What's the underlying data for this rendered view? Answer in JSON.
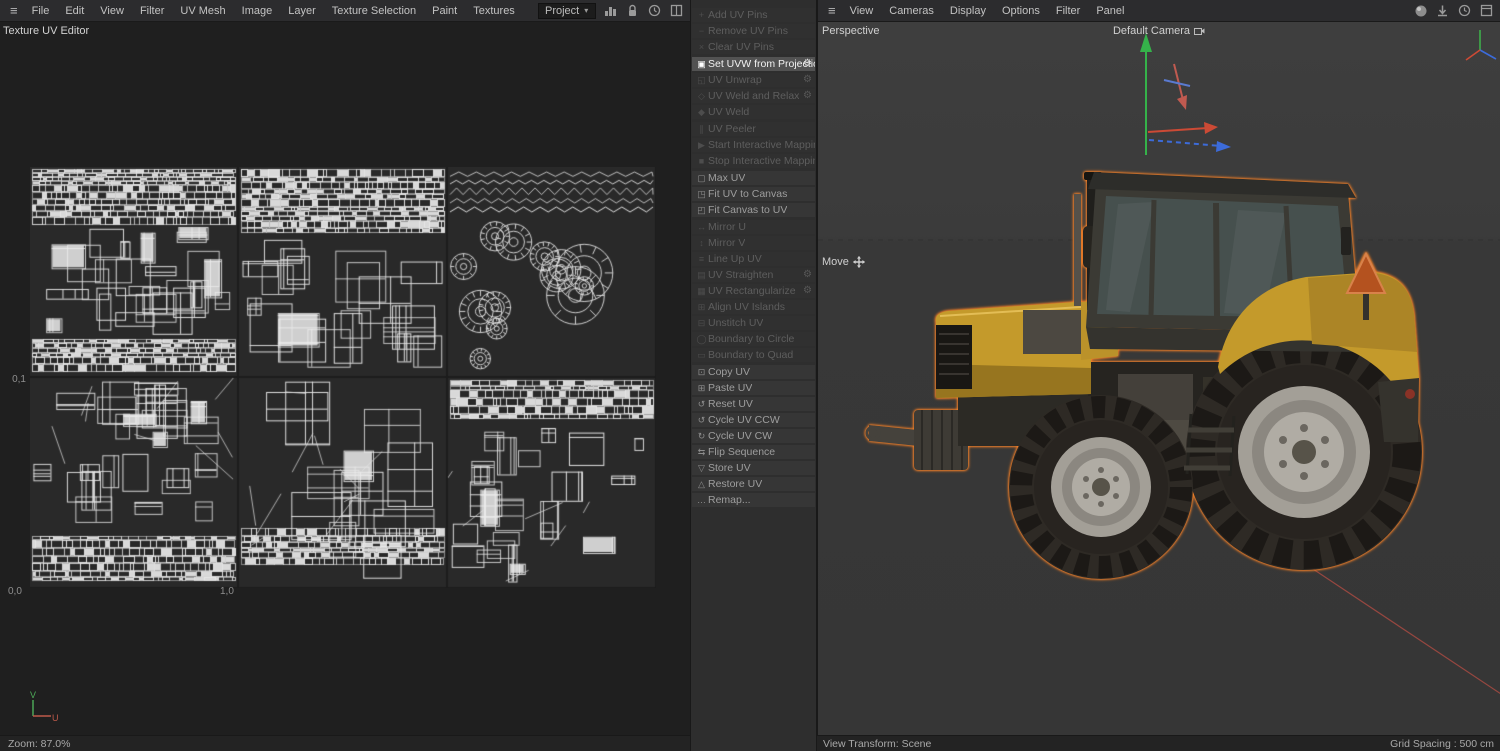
{
  "colors": {
    "accent_yellow": "#c49a2b",
    "selection_outline": "#ff8426",
    "axis_x": "#cc4a35",
    "axis_y": "#35b24a",
    "axis_z": "#3c6bd9"
  },
  "left_menubar": {
    "items": [
      "File",
      "Edit",
      "View",
      "Filter",
      "UV Mesh",
      "Image",
      "Layer",
      "Texture Selection",
      "Paint",
      "Textures"
    ]
  },
  "project_bar": {
    "selector_label": "Project"
  },
  "uv_editor": {
    "title": "Texture UV Editor",
    "coord_labels": {
      "v1": "0,1",
      "origin": "0,0",
      "u1": "1,0"
    },
    "axis": {
      "v": "V",
      "u": "U"
    },
    "status_zoom": "Zoom: 87.0%"
  },
  "command_panel": {
    "groups": [
      {
        "items": [
          {
            "label": "Add UV Pins",
            "icon": "add-pin",
            "glyph": "+",
            "state": "disabled",
            "gear": false
          },
          {
            "label": "Remove UV Pins",
            "icon": "remove-pin",
            "glyph": "−",
            "state": "disabled",
            "gear": false
          },
          {
            "label": "Clear UV Pins",
            "icon": "clear-pins",
            "glyph": "×",
            "state": "disabled",
            "gear": false
          }
        ]
      },
      {
        "items": [
          {
            "label": "Set UVW from Projection",
            "icon": "checkbox-checked",
            "glyph": "▣",
            "state": "active",
            "gear": true
          },
          {
            "label": "UV Unwrap",
            "icon": "uv-unwrap",
            "glyph": "◱",
            "state": "disabled",
            "gear": true
          },
          {
            "label": "UV Weld and Relax",
            "icon": "uv-weld-relax",
            "glyph": "◇",
            "state": "disabled",
            "gear": true
          },
          {
            "label": "UV Weld",
            "icon": "uv-weld",
            "glyph": "◆",
            "state": "disabled",
            "gear": false
          }
        ]
      },
      {
        "items": [
          {
            "label": "UV Peeler",
            "icon": "uv-peeler",
            "glyph": "∥",
            "state": "disabled",
            "gear": false
          },
          {
            "label": "Start Interactive Mapping",
            "icon": "start-interactive-mapping",
            "glyph": "▶",
            "state": "disabled",
            "gear": false
          },
          {
            "label": "Stop Interactive Mapping",
            "icon": "stop-interactive-mapping",
            "glyph": "■",
            "state": "disabled",
            "gear": false
          }
        ]
      },
      {
        "items": [
          {
            "label": "Max UV",
            "icon": "max-uv",
            "glyph": "▢",
            "state": "normal",
            "gear": false
          },
          {
            "label": "Fit UV to Canvas",
            "icon": "fit-uv-to-canvas",
            "glyph": "◳",
            "state": "normal",
            "gear": false
          },
          {
            "label": "Fit Canvas to UV",
            "icon": "fit-canvas-to-uv",
            "glyph": "◰",
            "state": "normal",
            "gear": false
          }
        ]
      },
      {
        "items": [
          {
            "label": "Mirror U",
            "icon": "mirror-u",
            "glyph": "↔",
            "state": "disabled",
            "gear": false
          },
          {
            "label": "Mirror V",
            "icon": "mirror-v",
            "glyph": "↕",
            "state": "disabled",
            "gear": false
          },
          {
            "label": "Line Up UV",
            "icon": "line-up-uv",
            "glyph": "≡",
            "state": "disabled",
            "gear": false
          },
          {
            "label": "UV Straighten",
            "icon": "uv-straighten",
            "glyph": "▤",
            "state": "disabled",
            "gear": true
          },
          {
            "label": "UV Rectangularize",
            "icon": "uv-rectangularize",
            "glyph": "▦",
            "state": "disabled",
            "gear": true
          },
          {
            "label": "Align UV Islands",
            "icon": "align-uv-islands",
            "glyph": "⊞",
            "state": "disabled",
            "gear": false
          },
          {
            "label": "Unstitch UV",
            "icon": "unstitch-uv",
            "glyph": "⊟",
            "state": "disabled",
            "gear": false
          },
          {
            "label": "Boundary to Circle",
            "icon": "boundary-to-circle",
            "glyph": "◯",
            "state": "disabled",
            "gear": false
          },
          {
            "label": "Boundary to Quad",
            "icon": "boundary-to-quad",
            "glyph": "▭",
            "state": "disabled",
            "gear": false
          }
        ]
      },
      {
        "items": [
          {
            "label": "Copy UV",
            "icon": "copy-uv",
            "glyph": "⊡",
            "state": "normal",
            "gear": false
          },
          {
            "label": "Paste UV",
            "icon": "paste-uv",
            "glyph": "⊞",
            "state": "normal",
            "gear": false
          },
          {
            "label": "Reset UV",
            "icon": "reset-uv",
            "glyph": "↺",
            "state": "normal",
            "gear": false
          },
          {
            "label": "Cycle UV CCW",
            "icon": "cycle-uv-ccw",
            "glyph": "↺",
            "state": "normal",
            "gear": false
          },
          {
            "label": "Cycle UV CW",
            "icon": "cycle-uv-cw",
            "glyph": "↻",
            "state": "normal",
            "gear": false
          },
          {
            "label": "Flip Sequence",
            "icon": "flip-sequence",
            "glyph": "⇆",
            "state": "normal",
            "gear": false
          },
          {
            "label": "Store UV",
            "icon": "store-uv",
            "glyph": "▽",
            "state": "normal",
            "gear": false
          },
          {
            "label": "Restore UV",
            "icon": "restore-uv",
            "glyph": "△",
            "state": "normal",
            "gear": false
          },
          {
            "label": "Remap...",
            "icon": "remap",
            "glyph": "…",
            "state": "normal",
            "gear": false
          }
        ]
      }
    ]
  },
  "viewport": {
    "menubar": [
      "View",
      "Cameras",
      "Display",
      "Options",
      "Filter",
      "Panel"
    ],
    "view_label": "Perspective",
    "camera_label": "Default Camera",
    "tool_label": "Move",
    "status_left": "View Transform: Scene",
    "status_right": "Grid Spacing : 500 cm"
  }
}
